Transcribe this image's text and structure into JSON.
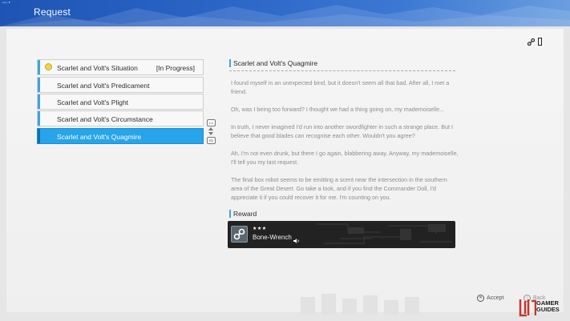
{
  "header": {
    "title": "Request",
    "tiny_label": "•••••• ▼"
  },
  "quests": [
    {
      "label": "Scarlet and Volt's Situation",
      "status": "[In Progress]",
      "selected": false,
      "has_icon": true
    },
    {
      "label": "Scarlet and Volt's Predicament",
      "status": "",
      "selected": false,
      "has_icon": false
    },
    {
      "label": "Scarlet and Volt's Plight",
      "status": "",
      "selected": false,
      "has_icon": false
    },
    {
      "label": "Scarlet and Volt's Circumstance",
      "status": "",
      "selected": false,
      "has_icon": false
    },
    {
      "label": "Scarlet and Volt's Quagmire",
      "status": "",
      "selected": true,
      "has_icon": false
    }
  ],
  "scroll": {
    "up": "L2",
    "down": "R2"
  },
  "detail": {
    "title": "Scarlet and Volt's Quagmire",
    "paragraphs": [
      "I found myself in an unexpected bind, but it doesn't seem all that bad. After all, I met a friend.",
      "Oh, was I being too forward? I thought we had a thing going on, my mademoiselle...",
      "In truth, I never imagined I'd run into another swordfighter in such a strange place. But I believe that good blades can recognise each other. Wouldn't you agree?",
      "Ah, I'm not even drunk, but there I go again, blabbering away. Anyway, my mademoiselle, I'll tell you my last request.",
      "The final box robot seems to be emitting a scent near the intersection in the southern area of the Great Desert. Go take a look, and if you find the Commander Doll, I'd appreciate it if you could recover it for me. I'm counting on you."
    ]
  },
  "reward": {
    "heading": "Reward",
    "stars": "★★★",
    "item": "Bone-Wrench",
    "icon": "wrench-icon"
  },
  "footer": {
    "accept_button": "✕",
    "accept_label": "Accept",
    "back_button": "○",
    "back_label": "Back"
  },
  "watermark": {
    "line1": "GAMER",
    "line2": "GUIDES"
  },
  "colors": {
    "accent": "#3ba6de",
    "selected": "#27a4ea",
    "header": "#2a63c4"
  }
}
